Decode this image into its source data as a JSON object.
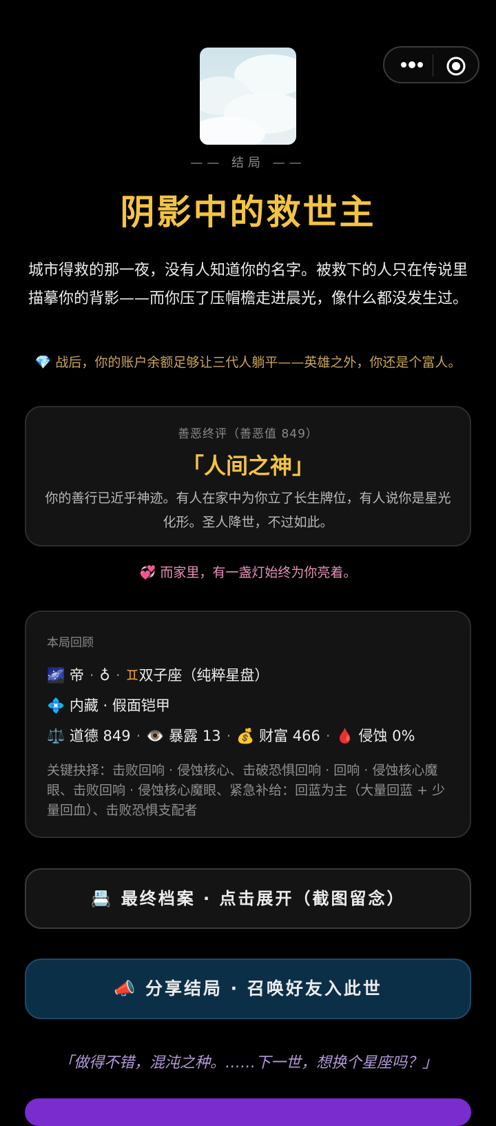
{
  "header": {
    "more_icon": "more-dots-icon",
    "close_icon": "target-circle-icon"
  },
  "ending": {
    "label": "—— 结局 ——",
    "title": "阴影中的救世主",
    "narrative": "城市得救的那一夜，没有人知道你的名字。被救下的人只在传说里描摹你的背影——而你压了压帽檐走进晨光，像什么都没发生过。",
    "wealth_icon": "💎",
    "wealth_text": "战后，你的账户余额足够让三代人躺平——英雄之外，你还是个富人。"
  },
  "verdict": {
    "label": "善恶终评（善恶值 849）",
    "title": "「人间之神」",
    "description": "你的善行已近乎神迹。有人在家中为你立了长生牌位，有人说你是星光化形。圣人降世，不过如此。"
  },
  "family": {
    "icon": "💞",
    "text": "而家里，有一盏灯始终为你亮着。"
  },
  "recap": {
    "label": "本局回顾",
    "row1": {
      "icon": "🌌",
      "role": "帝",
      "gender": "♁",
      "sign_icon": "♊",
      "sign": "双子座（纯粹星盘）"
    },
    "row2": {
      "icon": "💠",
      "text": "内藏 · 假面铠甲"
    },
    "stats": [
      {
        "icon": "⚖️",
        "label": "道德",
        "value": "849"
      },
      {
        "icon": "👁️",
        "label": "暴露",
        "value": "13"
      },
      {
        "icon": "💰",
        "label": "财富",
        "value": "466"
      },
      {
        "icon": "🩸",
        "label": "侵蚀",
        "value": "0%"
      }
    ],
    "key_choices": "关键抉择：击败回响 · 侵蚀核心、击破恐惧回响 · 回响 · 侵蚀核心魔眼、击败回响 · 侵蚀核心魔眼、紧急补给：回蓝为主（大量回蓝 + 少量回血）、击败恐惧支配者"
  },
  "buttons": {
    "archive_icon": "📇",
    "archive_label": "最终档案 · 点击展开（截图留念）",
    "share_icon": "📣",
    "share_label": "分享结局 · 召唤好友入此世"
  },
  "prompt": "「做得不错，混沌之种。……下一世，想换个星座吗？」",
  "colors": {
    "gold": "#f3c443",
    "pink": "#e591b9",
    "share_bg": "#0b2f47",
    "purple": "#7a2ccf"
  }
}
